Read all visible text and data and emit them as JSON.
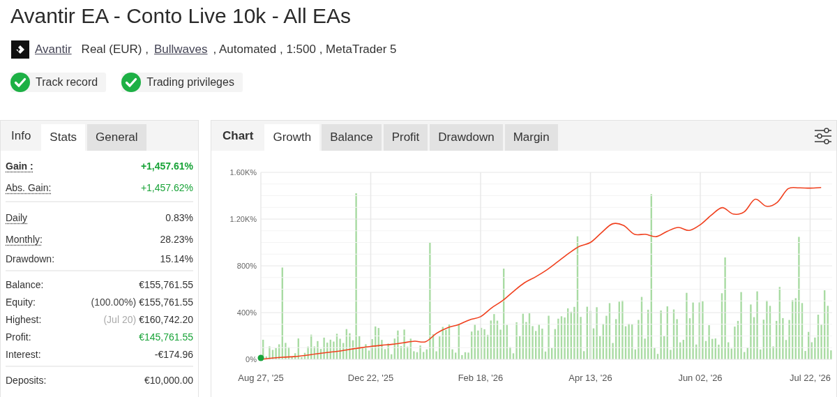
{
  "title": "Avantir EA - Conto Live 10k - All EAs",
  "meta": {
    "author": "Avantir",
    "account": "Real (EUR) ,",
    "broker": "Bullwaves",
    "details": ", Automated , 1:500 , MetaTrader 5"
  },
  "badges": [
    {
      "label": "Track record",
      "checked": true
    },
    {
      "label": "Trading privileges",
      "checked": true
    }
  ],
  "stats_panel": {
    "heading": "Info",
    "tabs": [
      {
        "label": "Stats",
        "selected": true
      },
      {
        "label": "General",
        "selected": false
      }
    ],
    "groups": [
      {
        "rows": [
          {
            "label": "Gain :",
            "value": "+1,457.61%",
            "positive": true,
            "bold": true,
            "underlined": true
          },
          {
            "label": "Abs. Gain:",
            "value": "+1,457.62%",
            "positive": true,
            "bold": false,
            "underlined": true
          }
        ]
      },
      {
        "rows": [
          {
            "label": "Daily",
            "value": "0.83%",
            "positive": false,
            "bold": false,
            "underlined": true
          },
          {
            "label": "Monthly:",
            "value": "28.23%",
            "positive": false,
            "bold": false,
            "underlined": true
          },
          {
            "label": "Drawdown:",
            "value": "15.14%",
            "positive": false,
            "bold": false,
            "underlined": false
          }
        ]
      },
      {
        "rows": [
          {
            "label": "Balance:",
            "value": "€155,761.55",
            "positive": false,
            "bold": false,
            "underlined": false
          },
          {
            "label": "Equity:",
            "note": "(100.00%)",
            "note_muted": false,
            "value": "€155,761.55",
            "positive": false,
            "bold": false,
            "underlined": false
          },
          {
            "label": "Highest:",
            "note": "(Jul 20)",
            "note_muted": true,
            "value": "€160,742.20",
            "positive": false,
            "bold": false,
            "underlined": false
          },
          {
            "label": "Profit:",
            "value": "€145,761.55",
            "positive": true,
            "bold": false,
            "underlined": false
          },
          {
            "label": "Interest:",
            "value": "-€174.96",
            "positive": false,
            "bold": false,
            "underlined": false
          }
        ]
      },
      {
        "rows": [
          {
            "label": "Deposits:",
            "value": "€10,000.00",
            "positive": false,
            "bold": false,
            "underlined": false
          }
        ]
      }
    ]
  },
  "chart_panel": {
    "heading": "Chart",
    "tabs": [
      {
        "label": "Growth",
        "selected": true
      },
      {
        "label": "Balance",
        "selected": false
      },
      {
        "label": "Profit",
        "selected": false
      },
      {
        "label": "Drawdown",
        "selected": false
      },
      {
        "label": "Margin",
        "selected": false
      }
    ],
    "chart_data": {
      "type": "line",
      "grid": true,
      "ylim": [
        0,
        1600
      ],
      "categories": [
        "Aug 27, '25",
        null,
        null,
        null,
        null,
        null,
        null,
        null,
        null,
        null,
        "Dec 22, '25",
        null,
        null,
        null,
        null,
        null,
        null,
        null,
        null,
        null,
        "Feb 18, '26",
        null,
        null,
        null,
        null,
        null,
        null,
        null,
        null,
        null,
        "Apr 13, '26",
        null,
        null,
        null,
        null,
        null,
        null,
        null,
        null,
        null,
        "Jun 02, '26",
        null,
        null,
        null,
        null,
        null,
        null,
        null,
        null,
        null,
        "Jul 22, '26",
        null
      ],
      "yticks": [
        {
          "value": 0,
          "label": "0%"
        },
        {
          "value": 400,
          "label": "400%"
        },
        {
          "value": 800,
          "label": "800%"
        },
        {
          "value": 1200,
          "label": "1.20K%"
        },
        {
          "value": 1600,
          "label": "1.60K%"
        }
      ],
      "series": [
        {
          "color": "#f0401e",
          "values": [
            0,
            10,
            18,
            23,
            33,
            46,
            58,
            69,
            84,
            98,
            110,
            120,
            129,
            142,
            155,
            151,
            223,
            270,
            297,
            338,
            365,
            440,
            502,
            582,
            655,
            705,
            763,
            833,
            905,
            967,
            1000,
            1083,
            1159,
            1146,
            1070,
            1070,
            1050,
            1096,
            1128,
            1103,
            1152,
            1233,
            1298,
            1243,
            1262,
            1370,
            1310,
            1343,
            1460,
            1467,
            1465,
            1470
          ]
        }
      ]
    }
  }
}
